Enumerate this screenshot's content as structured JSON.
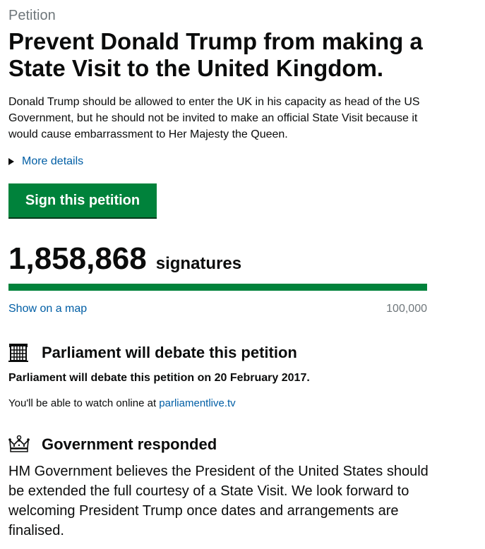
{
  "petition": {
    "caption": "Petition",
    "title": "Prevent Donald Trump from making a State Visit to the United Kingdom.",
    "summary": "Donald Trump should be allowed to enter the UK in his capacity as head of the US Government, but he should not be invited to make an official State Visit because it would cause embarrassment to Her Majesty the Queen.",
    "more_details_label": "More details",
    "sign_button_label": "Sign this petition"
  },
  "signatures": {
    "count": "1,858,868",
    "label": "signatures",
    "progress_fraction": 1.0,
    "show_map_label": "Show on a map",
    "threshold": "100,000"
  },
  "debate": {
    "icon": "portcullis-icon",
    "heading": "Parliament will debate this petition",
    "date_text": "Parliament will debate this petition on 20 February 2017.",
    "watch_prefix": "You'll be able to watch online at ",
    "watch_link": "parliamentlive.tv"
  },
  "government": {
    "icon": "crown-icon",
    "heading": "Government responded",
    "response": "HM Government believes the President of the United States should be extended the full courtesy of a State Visit. We look forward to welcoming President Trump once dates and arrangements are finalised."
  },
  "colors": {
    "accent_green": "#00823b",
    "link_blue": "#005ea5",
    "secondary_text": "#6f777b"
  }
}
